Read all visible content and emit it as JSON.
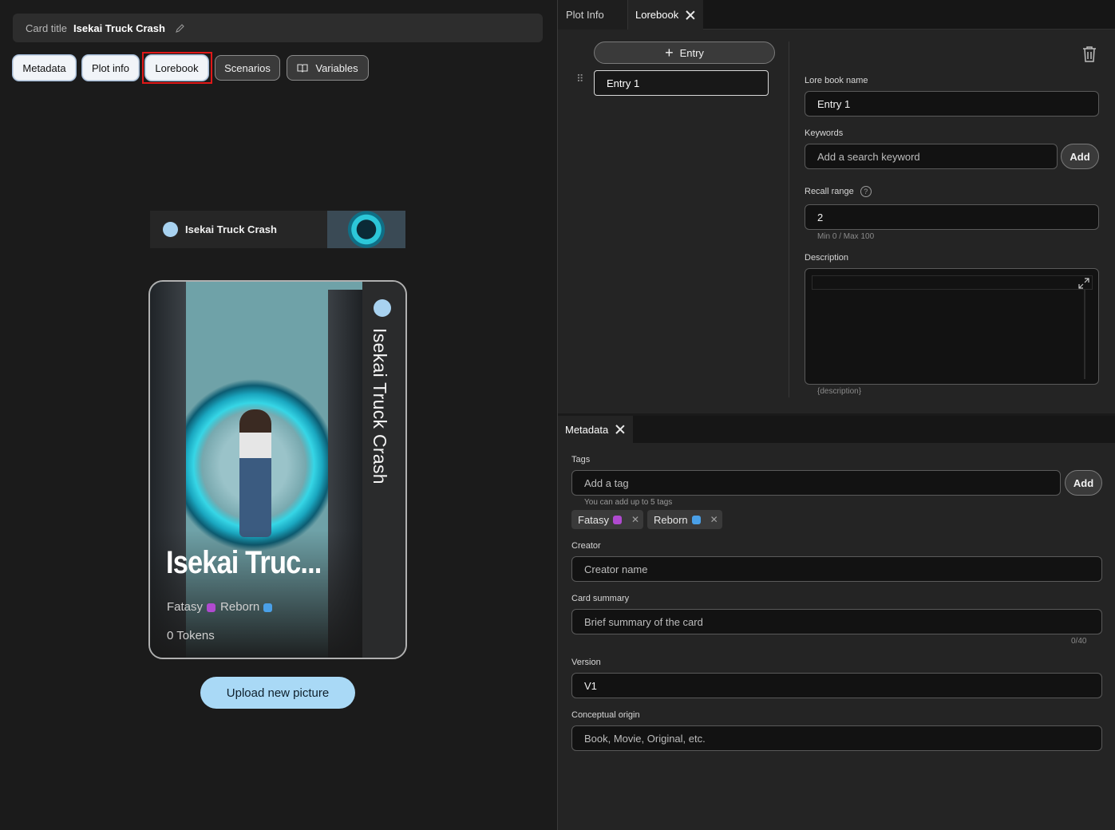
{
  "card_title": {
    "label": "Card title",
    "value": "Isekai Truck Crash"
  },
  "nav_buttons": {
    "metadata": "Metadata",
    "plot_info": "Plot info",
    "lorebook": "Lorebook",
    "scenarios": "Scenarios",
    "variables": "Variables"
  },
  "banner": {
    "title": "Isekai Truck Crash"
  },
  "preview_card": {
    "vertical_title": "Isekai Truck Crash",
    "title": "Isekai Truc...",
    "tags_line": "Fatasy",
    "tags_line2": "Reborn",
    "tokens": "0 Tokens"
  },
  "upload_button": "Upload new picture",
  "tabs": {
    "plot_info": "Plot Info",
    "lorebook": "Lorebook"
  },
  "lorebook": {
    "add_entry": "Entry",
    "entries": [
      {
        "label": "Entry 1"
      }
    ],
    "name_label": "Lore book name",
    "name_value": "Entry 1",
    "keywords_label": "Keywords",
    "keywords_placeholder": "Add a search keyword",
    "keywords_add": "Add",
    "recall_label": "Recall range",
    "recall_value": "2",
    "recall_hint": "Min 0 / Max 100",
    "description_label": "Description",
    "description_hint": "{description}"
  },
  "metadata": {
    "tab": "Metadata",
    "tags_label": "Tags",
    "tags_placeholder": "Add a tag",
    "tags_add": "Add",
    "tags_hint": "You can add up to 5 tags",
    "tags": [
      {
        "label": "Fatasy",
        "emoji_color": "#b04ad0"
      },
      {
        "label": "Reborn",
        "emoji_color": "#4aa0e8"
      }
    ],
    "creator_label": "Creator",
    "creator_placeholder": "Creator name",
    "summary_label": "Card summary",
    "summary_placeholder": "Brief summary of the card",
    "summary_count": "0/40",
    "version_label": "Version",
    "version_value": "V1",
    "origin_label": "Conceptual origin",
    "origin_placeholder": "Book, Movie, Original, etc."
  },
  "icons": {
    "edit": "pencil-icon",
    "book": "book-icon",
    "trash": "trash-icon",
    "close": "close-icon",
    "help": "help-circle-icon",
    "expand": "expand-icon",
    "drag": "drag-handle-icon",
    "plus": "plus-icon"
  },
  "colors": {
    "accent": "#a9d9f6",
    "highlight": "#e01818",
    "background": "#1b1b1b",
    "panel": "#242424"
  }
}
